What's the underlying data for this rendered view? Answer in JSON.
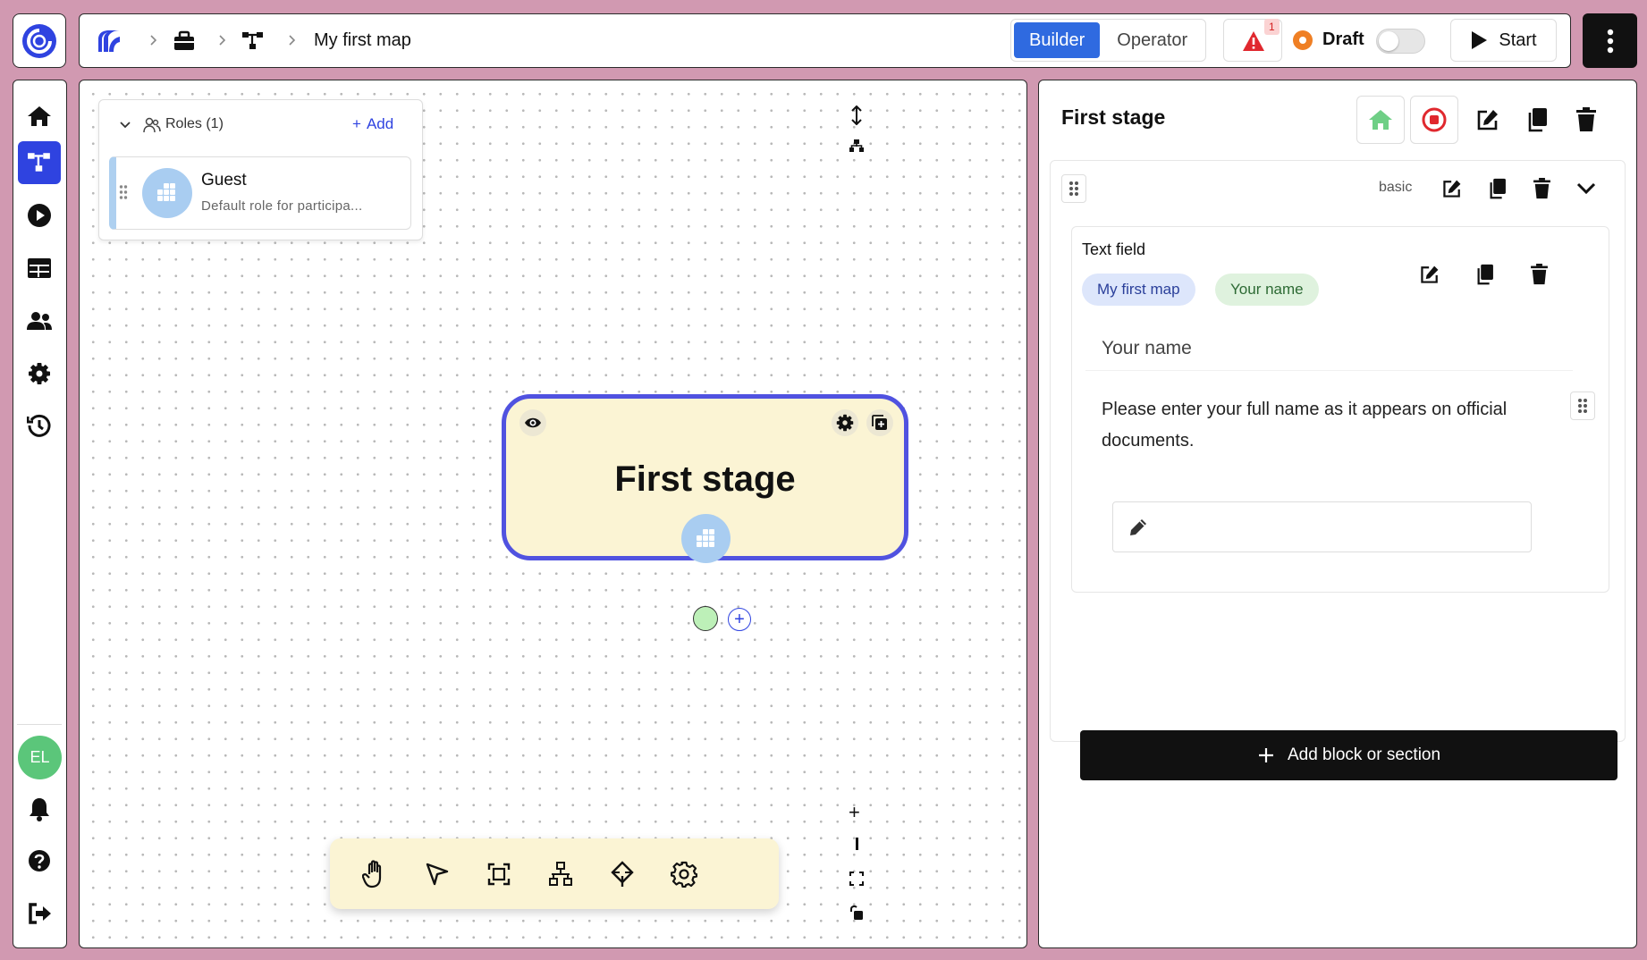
{
  "app": {
    "brand_color": "#2f43e0"
  },
  "breadcrumb": {
    "map_title": "My first map"
  },
  "modes": {
    "builder": "Builder",
    "operator": "Operator",
    "active": "Builder"
  },
  "alerts": {
    "count": "1"
  },
  "status": {
    "label": "Draft",
    "toggle_on": false
  },
  "start": {
    "label": "Start"
  },
  "sidebar": {
    "items": [
      {
        "name": "home-icon",
        "active": false
      },
      {
        "name": "map-icon",
        "active": true
      },
      {
        "name": "play-icon",
        "active": false
      },
      {
        "name": "table-icon",
        "active": false
      },
      {
        "name": "users-icon",
        "active": false
      },
      {
        "name": "gear-icon",
        "active": false
      },
      {
        "name": "history-icon",
        "active": false
      }
    ],
    "user_initials": "EL"
  },
  "roles": {
    "header": "Roles (1)",
    "add_label": "Add",
    "items": [
      {
        "name": "Guest",
        "description": "Default role for participa..."
      }
    ]
  },
  "stage": {
    "title": "First stage"
  },
  "detail": {
    "title": "First stage",
    "block": {
      "type_label": "basic"
    },
    "field": {
      "label": "Text field",
      "tags": [
        "My first map",
        "Your name"
      ],
      "question": "Your name",
      "description": "Please enter your full name as it appears on official documents."
    },
    "add_block_label": "Add block or section"
  }
}
